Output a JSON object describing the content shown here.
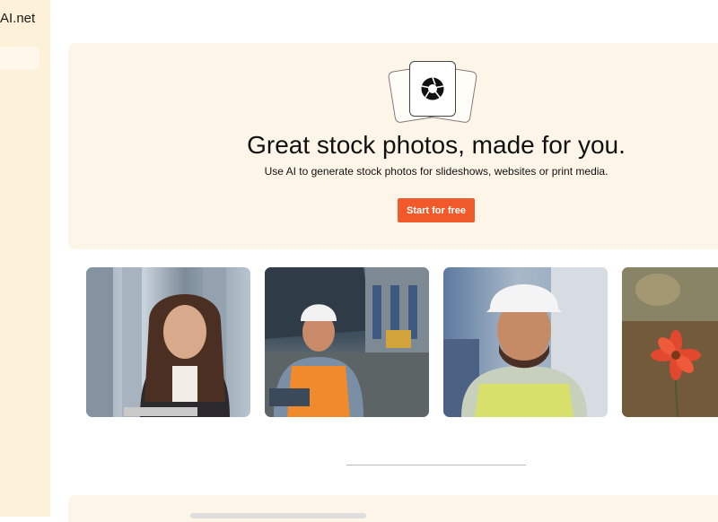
{
  "sidebar": {
    "brand": "AI.net"
  },
  "hero": {
    "title": "Great stock photos, made for you.",
    "subtitle": "Use AI to generate stock photos for slideshows, websites or print media.",
    "cta_label": "Start for free",
    "logo_icon": "camera-aperture-icon"
  },
  "gallery": {
    "photos": [
      {
        "subject": "woman-with-tablet"
      },
      {
        "subject": "worker-with-clipboard-at-port"
      },
      {
        "subject": "smiling-worker-in-hard-hat"
      },
      {
        "subject": "red-flower"
      }
    ]
  },
  "colors": {
    "accent": "#f05a2b",
    "sidebar_bg": "#fdf1d9",
    "hero_bg": "#fdf6e8"
  }
}
